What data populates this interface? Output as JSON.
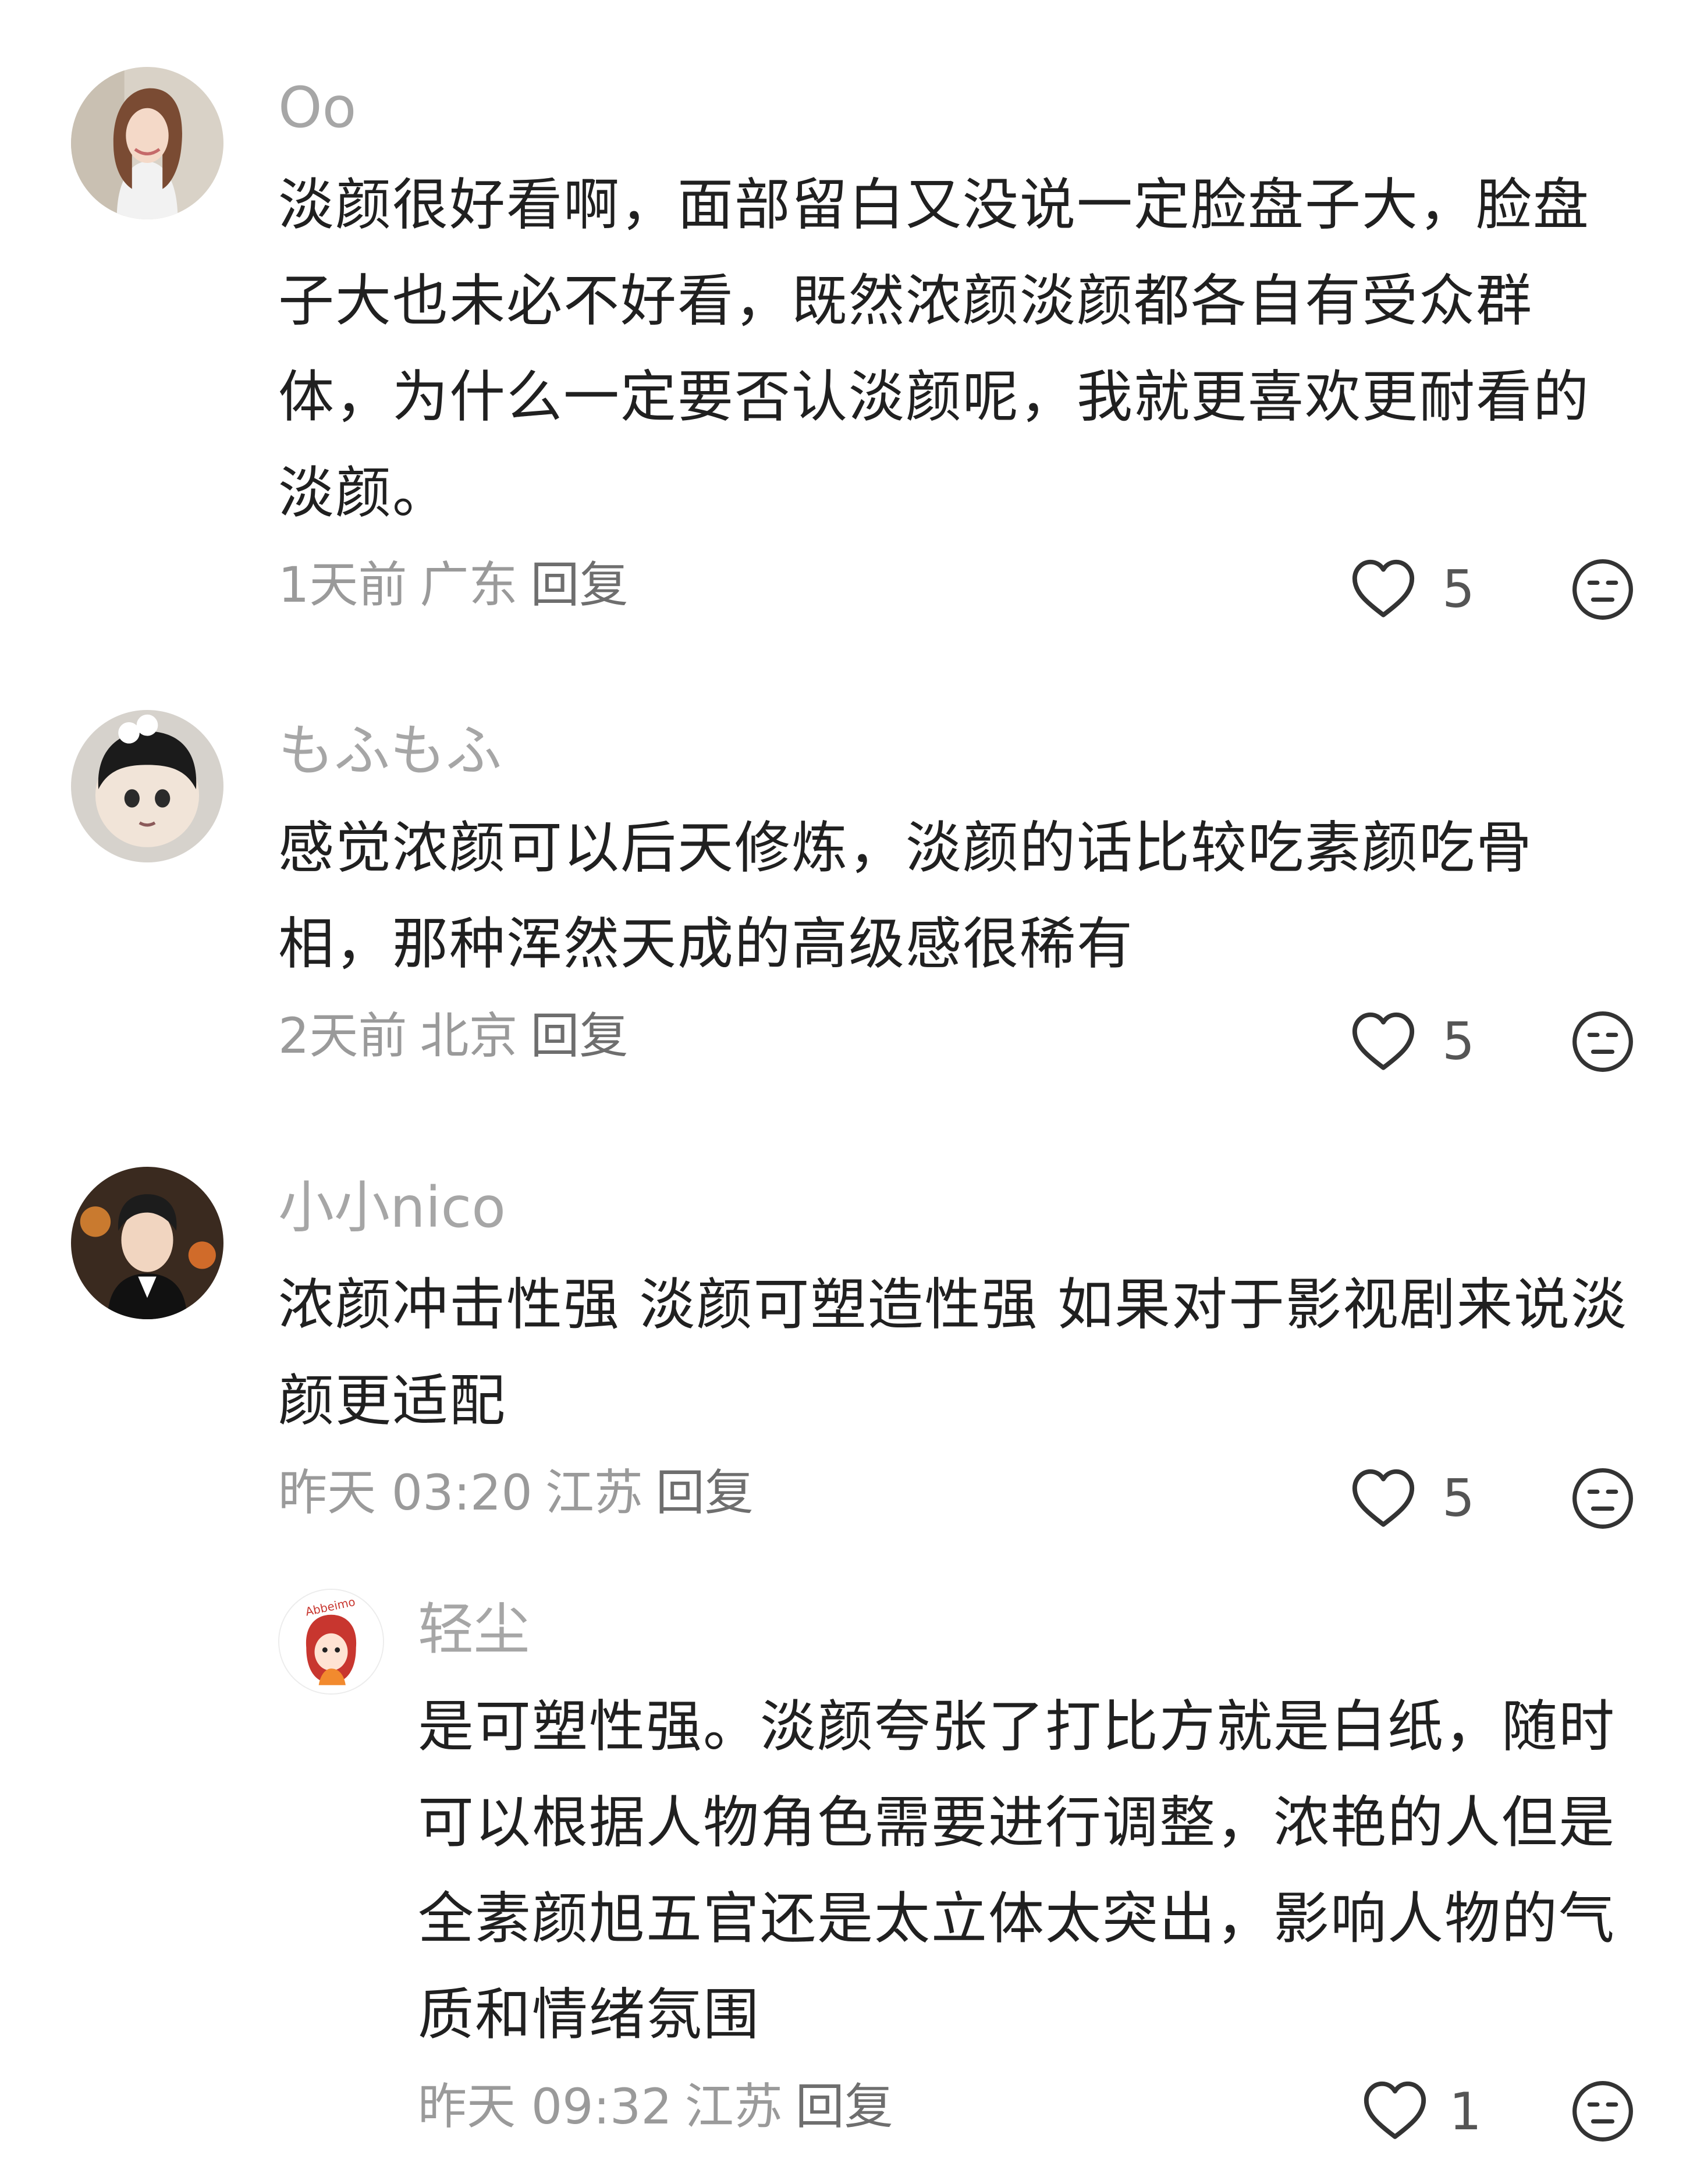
{
  "comments": [
    {
      "username": "Oo",
      "text": "淡颜很好看啊，面部留白又没说一定脸盘子大，脸盘子大也未必不好看，既然浓颜淡颜都各自有受众群体，为什么一定要否认淡颜呢，我就更喜欢更耐看的淡颜。",
      "time": "1天前",
      "location": "广东",
      "reply_label": "回复",
      "likes": "5"
    },
    {
      "username": "もふもふ",
      "text": "感觉浓颜可以后天修炼，淡颜的话比较吃素颜吃骨相，那种浑然天成的高级感很稀有",
      "time": "2天前",
      "location": "北京",
      "reply_label": "回复",
      "likes": "5"
    },
    {
      "username": "小小nico",
      "text": "浓颜冲击性强 淡颜可塑造性强 如果对于影视剧来说淡颜更适配",
      "time": "昨天 03:20",
      "location": "江苏",
      "reply_label": "回复",
      "likes": "5"
    },
    {
      "username": "轻尘",
      "text": "是可塑性强。淡颜夸张了打比方就是白纸，随时可以根据人物角色需要进行调整，浓艳的人但是全素颜旭五官还是太立体太突出，影响人物的气质和情绪氛围",
      "time": "昨天 09:32",
      "location": "江苏",
      "reply_label": "回复",
      "likes": "1",
      "avatar_text": "Abbeimo"
    }
  ],
  "icons": {
    "like": "heart-outline-icon",
    "dislike": "meh-face-icon"
  },
  "colors": {
    "username": "#a6a6a6",
    "body_text": "#202020",
    "meta_text": "#9a9a9a"
  }
}
